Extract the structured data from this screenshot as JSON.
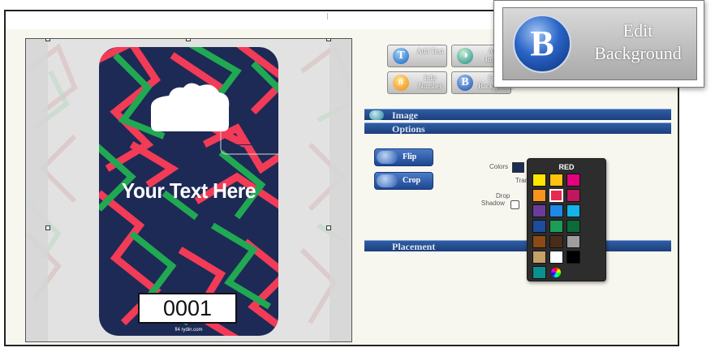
{
  "canvas": {
    "headline": "Your Text Here",
    "number": "0001",
    "brand": "fl4 rydin.com",
    "pattern_colors": [
      "#1d2a55",
      "#f23b57",
      "#21a852"
    ]
  },
  "toolbar": {
    "add_text": "Add Text",
    "add_image": "Add Image",
    "edit_number": "Edit Number",
    "edit_background": "Edit Background"
  },
  "sections": {
    "image": "Image",
    "options": "Options",
    "placement": "Placement"
  },
  "options": {
    "flip_label": "Flip",
    "crop_label": "Crop",
    "colors_label": "Colors",
    "transparency_label": "Tran",
    "drop_label": "Drop",
    "shadow_label": "Shadow",
    "drop_shadow_checked": false,
    "selected_colors": [
      "#1b2e55",
      "#e8284e",
      "#21a852"
    ]
  },
  "color_popup": {
    "title": "RED",
    "selected": "#e8284e",
    "swatches": [
      "#ffe600",
      "#ffc20e",
      "#e5007e",
      "#f7941d",
      "#e8284e",
      "#c2185b",
      "#6a3d9a",
      "#1e88e5",
      "#12b5e5",
      "#1c4e9b",
      "#1b9e58",
      "#0b6b3a",
      "#8b4a17",
      "#4a2c1a",
      "#9e9e9e",
      "#c4a06a",
      "#ffffff",
      "#000000",
      "#0b8f8f"
    ]
  },
  "zoom": {
    "icon_letter": "B",
    "label": "Edit Background"
  }
}
